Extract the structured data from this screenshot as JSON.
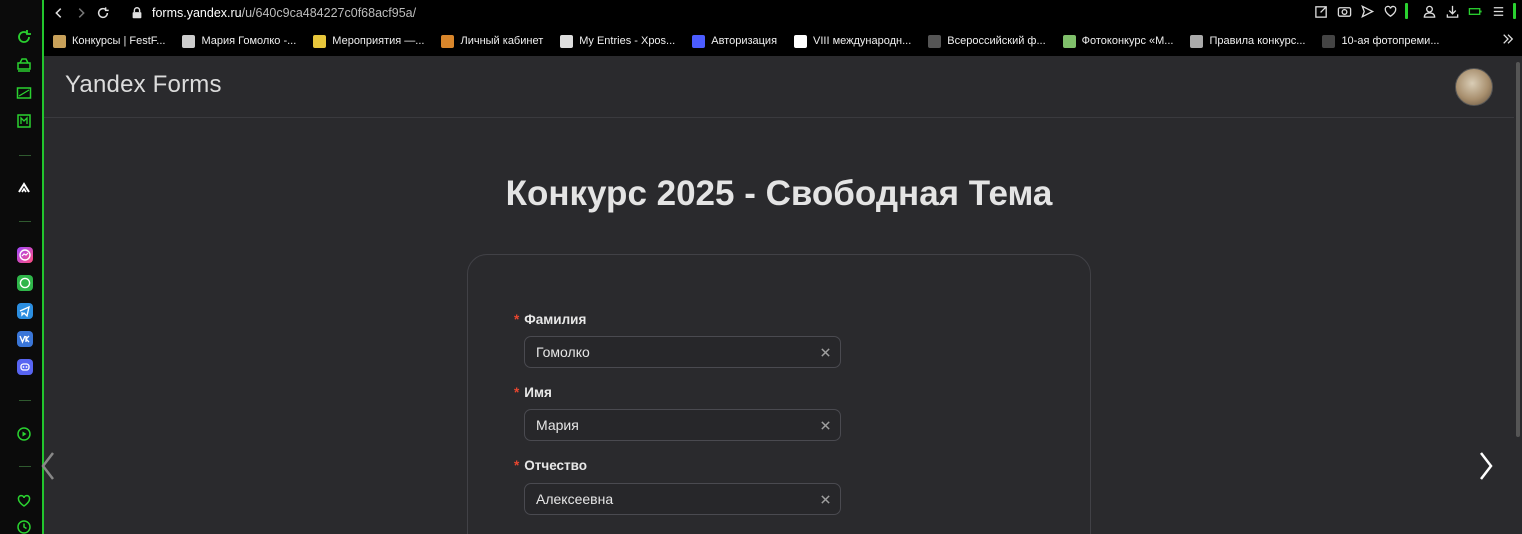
{
  "browser": {
    "url_host": "forms.yandex.ru",
    "url_path": "/u/640c9ca484227c0f68acf95a/",
    "accent": "#22c52d"
  },
  "bookmarks": [
    {
      "label": "Конкурсы | FestF...",
      "icon": "festf-icon",
      "color": "#c8a15a"
    },
    {
      "label": "Мария Гомолко -...",
      "icon": "grid-icon",
      "color": "#cccccc"
    },
    {
      "label": "Мероприятия —...",
      "icon": "m-icon",
      "color": "#e7c63b"
    },
    {
      "label": "Личный кабинет",
      "icon": "tn-icon",
      "color": "#d9862b"
    },
    {
      "label": "My Entries - Xpos...",
      "icon": "xpos-icon",
      "color": "#dddddd"
    },
    {
      "label": "Авторизация",
      "icon": "circle-icon",
      "color": "#4b5cff"
    },
    {
      "label": "VIII международн...",
      "icon": "doc-icon",
      "color": "#ffffff"
    },
    {
      "label": "Всероссийский ф...",
      "icon": "camera-icon",
      "color": "#555555"
    },
    {
      "label": "Фотоконкурс «М...",
      "icon": "leaf-icon",
      "color": "#7fbf6a"
    },
    {
      "label": "Правила конкурс...",
      "icon": "tower-icon",
      "color": "#aaaaaa"
    },
    {
      "label": "10-ая фотопреми...",
      "icon": "photo-icon",
      "color": "#444444"
    }
  ],
  "header": {
    "brand": "Yandex Forms"
  },
  "form": {
    "title": "Конкурс 2025 - Свободная Тема",
    "required_mark": "*",
    "fields": [
      {
        "label": "Фамилия",
        "value": "Гомолко"
      },
      {
        "label": "Имя",
        "value": "Мария"
      },
      {
        "label": "Отчество",
        "value": "Алексеевна"
      }
    ]
  }
}
